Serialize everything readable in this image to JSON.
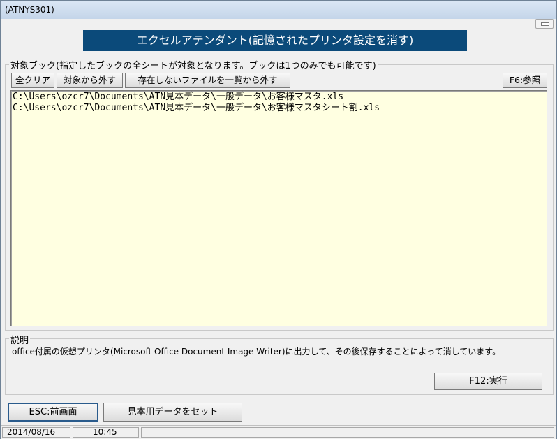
{
  "window": {
    "title": "(ATNYS301)"
  },
  "banner": {
    "text": "エクセルアテンダント(記憶されたプリンタ設定を消す)"
  },
  "target_group": {
    "label": "対象ブック(指定したブックの全シートが対象となります。ブックは1つのみでも可能です)",
    "buttons": {
      "clear_all": "全クリア",
      "remove": "対象から外す",
      "remove_missing": "存在しないファイルを一覧から外す",
      "browse": "F6:参照"
    },
    "files": [
      "C:\\Users\\ozcr7\\Documents\\ATN見本データ\\一般データ\\お客様マスタ.xls",
      "C:\\Users\\ozcr7\\Documents\\ATN見本データ\\一般データ\\お客様マスタシート割.xls"
    ]
  },
  "description_group": {
    "label": "説明",
    "text": "office付属の仮想プリンタ(Microsoft Office Document Image Writer)に出力して、その後保存することによって消しています。",
    "execute_button": "F12:実行"
  },
  "footer": {
    "back_button": "ESC:前画面",
    "sample_button": "見本用データをセット"
  },
  "status": {
    "date": "2014/08/16",
    "time": "10:45"
  }
}
